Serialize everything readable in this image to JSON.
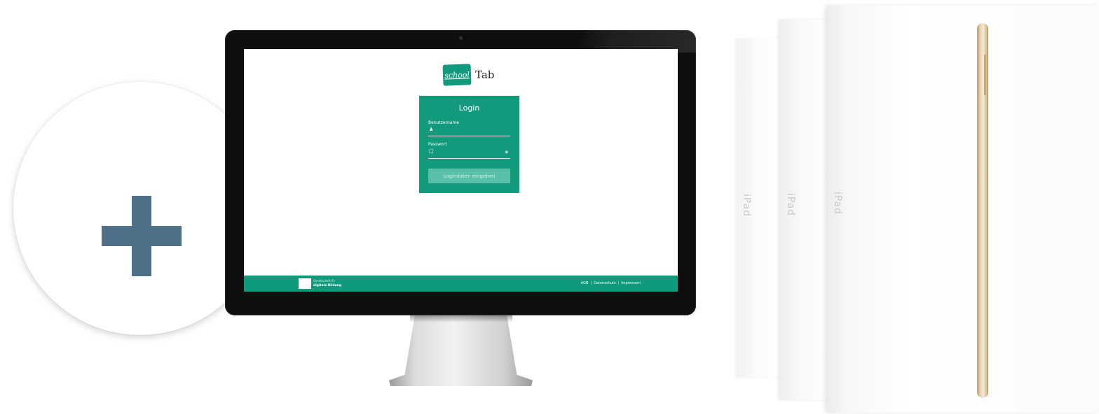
{
  "plus_badge": {
    "icon": "plus-icon",
    "color": "#4e7189"
  },
  "monitor": {
    "screen": {
      "logo": {
        "badge_text": "school",
        "name": "Tab",
        "brand_color": "#139a7c"
      },
      "login": {
        "title": "Login",
        "username_label": "Benutzername",
        "username_value": "",
        "username_icon": "user-icon",
        "password_label": "Passwort",
        "password_value": "",
        "password_icon": "lock-icon",
        "show_password_icon": "eye-icon",
        "submit_label": "Logindaten eingeben"
      },
      "footer": {
        "org_line1": "Gesellschaft für",
        "org_line2": "digitale Bildung",
        "links": [
          "AGB",
          "Datenschutz",
          "Impressum"
        ],
        "separator": "|"
      }
    }
  },
  "ipad_boxes": [
    {
      "label": "iPad"
    },
    {
      "label": "iPad"
    },
    {
      "label": "iPad"
    }
  ]
}
